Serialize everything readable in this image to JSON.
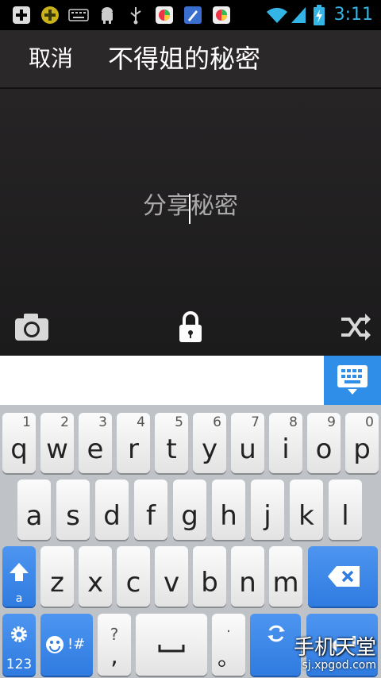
{
  "status_bar": {
    "time": "3:11",
    "icons": [
      "add-icon",
      "game-icon",
      "keyboard-icon",
      "android-icon",
      "usb-icon",
      "app-icon",
      "paint-icon",
      "app-icon",
      "wifi-icon",
      "signal-icon",
      "battery-charging-icon"
    ]
  },
  "header": {
    "cancel_label": "取消",
    "title": "不得姐的秘密"
  },
  "compose": {
    "placeholder": "分享秘密"
  },
  "keyboard": {
    "row1": [
      {
        "letter": "q",
        "num": "1"
      },
      {
        "letter": "w",
        "num": "2"
      },
      {
        "letter": "e",
        "num": "3"
      },
      {
        "letter": "r",
        "num": "4"
      },
      {
        "letter": "t",
        "num": "5"
      },
      {
        "letter": "y",
        "num": "6"
      },
      {
        "letter": "u",
        "num": "7"
      },
      {
        "letter": "i",
        "num": "8"
      },
      {
        "letter": "o",
        "num": "9"
      },
      {
        "letter": "p",
        "num": "0"
      }
    ],
    "row2": [
      "a",
      "s",
      "d",
      "f",
      "g",
      "h",
      "j",
      "k",
      "l"
    ],
    "row3": [
      "z",
      "x",
      "c",
      "v",
      "b",
      "n",
      "m"
    ],
    "shift_sub": "a",
    "settings_label": "123",
    "emoji_label": "!#",
    "punct_top": "?",
    "punct_bottom": ",",
    "period_top": "·",
    "period_bottom": "。"
  },
  "watermark": {
    "title": "手机天堂",
    "url": "sj.xpgod.com"
  },
  "colors": {
    "accent": "#2f8fe8",
    "time": "#33b5e5"
  }
}
